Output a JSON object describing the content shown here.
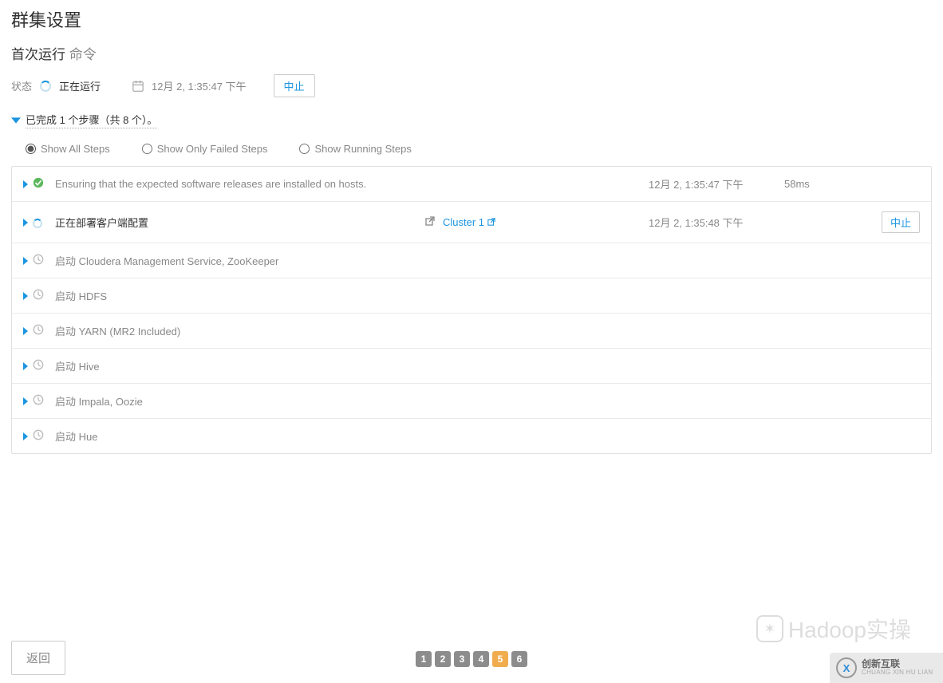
{
  "header": {
    "title": "群集设置",
    "subtitle_prefix": "首次运行",
    "subtitle_grey": "命令"
  },
  "status": {
    "label": "状态",
    "state_text": "正在运行",
    "timestamp": "12月 2, 1:35:47 下午",
    "abort_button": "中止"
  },
  "progress": {
    "text": "已完成 1 个步骤（共 8 个）。"
  },
  "filters": {
    "all": "Show All Steps",
    "failed": "Show Only Failed Steps",
    "running": "Show Running Steps"
  },
  "steps": [
    {
      "status": "ok",
      "desc": "Ensuring that the expected software releases are installed on hosts.",
      "desc_strong": false,
      "link_text": "",
      "timestamp": "12月 2, 1:35:47 下午",
      "duration": "58ms",
      "action": ""
    },
    {
      "status": "running",
      "desc": "正在部署客户端配置",
      "desc_strong": true,
      "link_text": "Cluster 1",
      "timestamp": "12月 2, 1:35:48 下午",
      "duration": "",
      "action": "中止"
    },
    {
      "status": "pending",
      "desc": "启动 Cloudera Management Service, ZooKeeper",
      "desc_strong": false,
      "link_text": "",
      "timestamp": "",
      "duration": "",
      "action": ""
    },
    {
      "status": "pending",
      "desc": "启动 HDFS",
      "desc_strong": false,
      "link_text": "",
      "timestamp": "",
      "duration": "",
      "action": ""
    },
    {
      "status": "pending",
      "desc": "启动 YARN (MR2 Included)",
      "desc_strong": false,
      "link_text": "",
      "timestamp": "",
      "duration": "",
      "action": ""
    },
    {
      "status": "pending",
      "desc": "启动 Hive",
      "desc_strong": false,
      "link_text": "",
      "timestamp": "",
      "duration": "",
      "action": ""
    },
    {
      "status": "pending",
      "desc": "启动 Impala, Oozie",
      "desc_strong": false,
      "link_text": "",
      "timestamp": "",
      "duration": "",
      "action": ""
    },
    {
      "status": "pending",
      "desc": "启动 Hue",
      "desc_strong": false,
      "link_text": "",
      "timestamp": "",
      "duration": "",
      "action": ""
    }
  ],
  "footer": {
    "back": "返回"
  },
  "pager": {
    "pages": [
      "1",
      "2",
      "3",
      "4",
      "5",
      "6"
    ],
    "active": "5"
  },
  "watermark1": "Hadoop实操",
  "watermark2": {
    "cn": "创新互联",
    "en": "CHUANG XIN HU LIAN"
  }
}
